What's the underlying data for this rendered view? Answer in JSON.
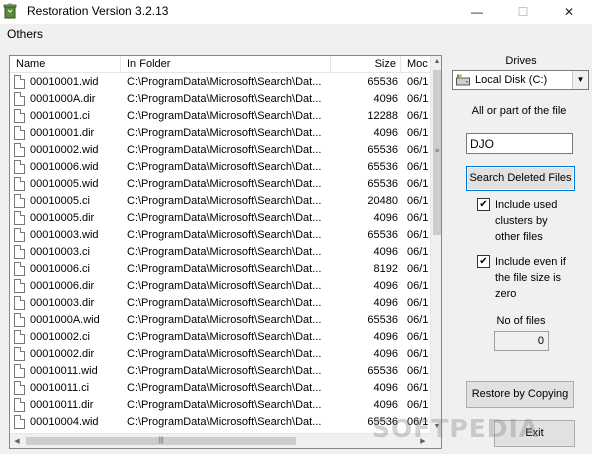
{
  "window": {
    "title": "Restoration Version 3.2.13",
    "minimize": "—",
    "maximize": "☐",
    "close": "✕"
  },
  "menu": {
    "items": [
      "Others"
    ]
  },
  "list": {
    "columns": [
      "Name",
      "In Folder",
      "Size",
      "Moc"
    ],
    "rows": [
      {
        "name": "00010001.wid",
        "folder": "C:\\ProgramData\\Microsoft\\Search\\Dat...",
        "size": "65536",
        "mod": "06/1"
      },
      {
        "name": "0001000A.dir",
        "folder": "C:\\ProgramData\\Microsoft\\Search\\Dat...",
        "size": "4096",
        "mod": "06/1"
      },
      {
        "name": "00010001.ci",
        "folder": "C:\\ProgramData\\Microsoft\\Search\\Dat...",
        "size": "12288",
        "mod": "06/1"
      },
      {
        "name": "00010001.dir",
        "folder": "C:\\ProgramData\\Microsoft\\Search\\Dat...",
        "size": "4096",
        "mod": "06/1"
      },
      {
        "name": "00010002.wid",
        "folder": "C:\\ProgramData\\Microsoft\\Search\\Dat...",
        "size": "65536",
        "mod": "06/1"
      },
      {
        "name": "00010006.wid",
        "folder": "C:\\ProgramData\\Microsoft\\Search\\Dat...",
        "size": "65536",
        "mod": "06/1"
      },
      {
        "name": "00010005.wid",
        "folder": "C:\\ProgramData\\Microsoft\\Search\\Dat...",
        "size": "65536",
        "mod": "06/1"
      },
      {
        "name": "00010005.ci",
        "folder": "C:\\ProgramData\\Microsoft\\Search\\Dat...",
        "size": "20480",
        "mod": "06/1"
      },
      {
        "name": "00010005.dir",
        "folder": "C:\\ProgramData\\Microsoft\\Search\\Dat...",
        "size": "4096",
        "mod": "06/1"
      },
      {
        "name": "00010003.wid",
        "folder": "C:\\ProgramData\\Microsoft\\Search\\Dat...",
        "size": "65536",
        "mod": "06/1"
      },
      {
        "name": "00010003.ci",
        "folder": "C:\\ProgramData\\Microsoft\\Search\\Dat...",
        "size": "4096",
        "mod": "06/1"
      },
      {
        "name": "00010006.ci",
        "folder": "C:\\ProgramData\\Microsoft\\Search\\Dat...",
        "size": "8192",
        "mod": "06/1"
      },
      {
        "name": "00010006.dir",
        "folder": "C:\\ProgramData\\Microsoft\\Search\\Dat...",
        "size": "4096",
        "mod": "06/1"
      },
      {
        "name": "00010003.dir",
        "folder": "C:\\ProgramData\\Microsoft\\Search\\Dat...",
        "size": "4096",
        "mod": "06/1"
      },
      {
        "name": "0001000A.wid",
        "folder": "C:\\ProgramData\\Microsoft\\Search\\Dat...",
        "size": "65536",
        "mod": "06/1"
      },
      {
        "name": "00010002.ci",
        "folder": "C:\\ProgramData\\Microsoft\\Search\\Dat...",
        "size": "4096",
        "mod": "06/1"
      },
      {
        "name": "00010002.dir",
        "folder": "C:\\ProgramData\\Microsoft\\Search\\Dat...",
        "size": "4096",
        "mod": "06/1"
      },
      {
        "name": "00010011.wid",
        "folder": "C:\\ProgramData\\Microsoft\\Search\\Dat...",
        "size": "65536",
        "mod": "06/1"
      },
      {
        "name": "00010011.ci",
        "folder": "C:\\ProgramData\\Microsoft\\Search\\Dat...",
        "size": "4096",
        "mod": "06/1"
      },
      {
        "name": "00010011.dir",
        "folder": "C:\\ProgramData\\Microsoft\\Search\\Dat...",
        "size": "4096",
        "mod": "06/1"
      },
      {
        "name": "00010004.wid",
        "folder": "C:\\ProgramData\\Microsoft\\Search\\Dat...",
        "size": "65536",
        "mod": "06/1"
      }
    ]
  },
  "panel": {
    "drives_label": "Drives",
    "drive_selected": "Local Disk (C:)",
    "allpart_label": "All or part of the file",
    "file_input_value": "DJO",
    "search_button": "Search Deleted Files",
    "include_used_label": "Include used clusters by other files",
    "include_used_checked": true,
    "include_zero_label": "Include even if the file size is zero",
    "include_zero_checked": true,
    "nof_label": "No of files",
    "nof_value": "0",
    "restore_button": "Restore by Copying",
    "exit_button": "Exit"
  },
  "watermark": "SOFTPEDIA",
  "icons": {
    "app": "recycle-bin-icon",
    "drive": "drive-icon",
    "file": "file-icon"
  }
}
